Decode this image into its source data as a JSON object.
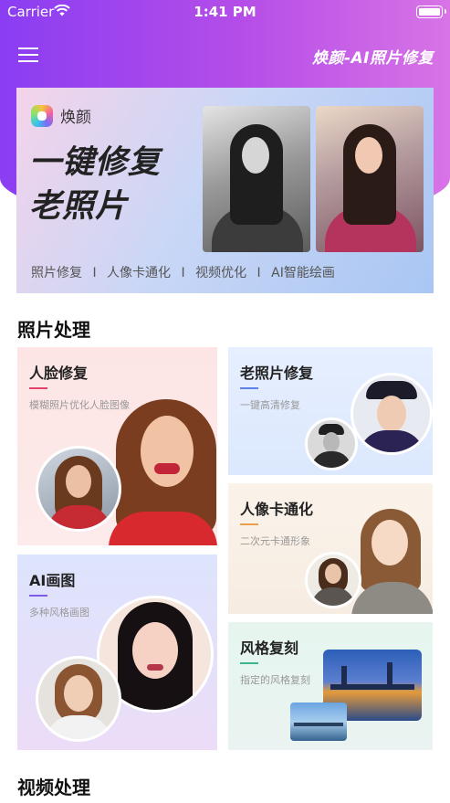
{
  "status_bar": {
    "carrier": "Carrier",
    "time": "1:41 PM"
  },
  "header": {
    "menu_icon": "hamburger-menu-icon",
    "title": "焕颜-AI照片修复"
  },
  "banner": {
    "brand": "焕颜",
    "headline_line1": "一键修复",
    "headline_line2": "老照片",
    "tags": [
      "照片修复",
      "人像卡通化",
      "视频优化",
      "AI智能绘画"
    ],
    "tag_separator": "I"
  },
  "sections": {
    "photo": "照片处理",
    "video": "视频处理"
  },
  "cards": {
    "face_repair": {
      "title": "人脸修复",
      "subtitle": "模糊照片优化人脸图像"
    },
    "old_photo": {
      "title": "老照片修复",
      "subtitle": "一键高清修复"
    },
    "cartoon": {
      "title": "人像卡通化",
      "subtitle": "二次元卡通形象"
    },
    "ai_paint": {
      "title": "AI画图",
      "subtitle": "多种风格画图"
    },
    "style_copy": {
      "title": "风格复刻",
      "subtitle": "指定的风格复刻"
    }
  },
  "colors": {
    "header_gradient_start": "#8a3df2",
    "header_gradient_end": "#d874e6",
    "accent": "#e2436a"
  }
}
